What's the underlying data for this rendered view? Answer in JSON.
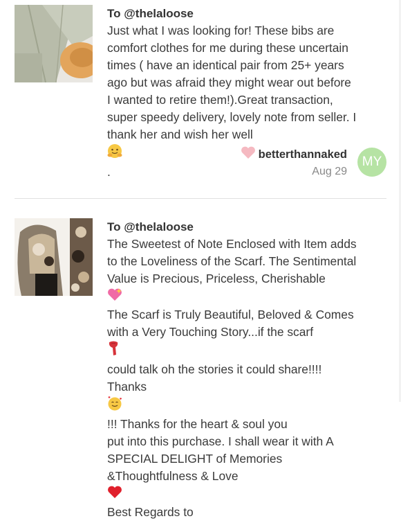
{
  "reviews": [
    {
      "to": "To @thelaloose",
      "lines": [
        "Just what I was looking for! These bibs are",
        "comfort clothes for me during these uncertain",
        "times ( have an identical pair from 25+ years",
        "ago but was afraid they might wear out before",
        "I wanted to retire them!).Great transaction,",
        "super speedy delivery, lovely note from seller. I",
        "thank her and wish her well"
      ],
      "line_end": ".",
      "username": "betterthannaked",
      "date": "Aug 29",
      "avatar_initials": "MY",
      "avatar_color": "#b6e3a4"
    },
    {
      "to": "To @thelaloose",
      "lines": [
        "The Sweetest of Note Enclosed with Item adds",
        "to the Loveliness of the Scarf. The Sentimental",
        "Value is Precious, Priceless, Cherishable",
        "The Scarf is Truly Beautiful, Beloved & Comes",
        "with a Very Touching Story...if the scarf",
        "could talk oh the stories it could share!!!!",
        "Thanks",
        "put into this purchase. I shall wear it with A",
        "SPECIAL DELIGHT of Memories",
        "&Thoughtfulness & Love"
      ],
      "thanks_tail": "!!! Thanks for the heart & soul you",
      "last_tail": " Best Regards to"
    }
  ],
  "icons": {
    "heart_color": "#f5b9c1",
    "hugging": "hugging-face-icon",
    "sparkling_heart": "sparkling-heart-icon",
    "scarf": "scarf-icon",
    "smiling_hearts": "smiling-face-hearts-icon",
    "red_heart": "red-heart-icon"
  }
}
